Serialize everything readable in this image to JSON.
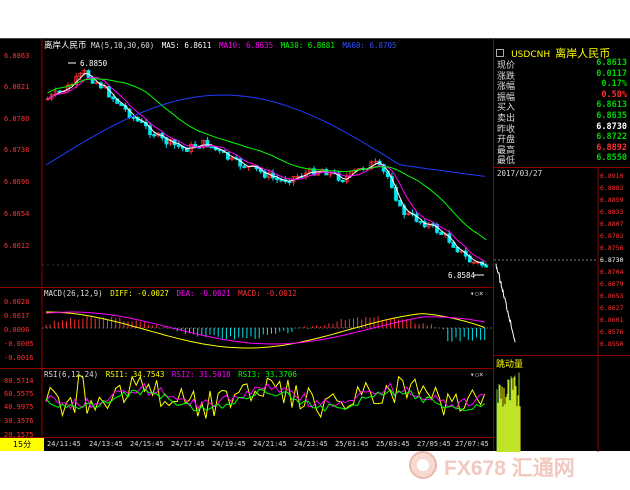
{
  "main": {
    "symbol": "离岸人民币",
    "ma_label": "MA(5,10,30,60)",
    "ma5": "MA5: 6.8611",
    "ma10": "MA10: 6.8635",
    "ma30": "MA30: 6.8681",
    "ma60": "MA60: 6.8705",
    "y_ticks": [
      "6.8863",
      "6.8821",
      "6.8780",
      "6.8738",
      "6.8696",
      "6.8654",
      "6.8612"
    ],
    "hi_label": "6.8850",
    "lo_label": "6.8584"
  },
  "macd": {
    "title": "MACD(26,12,9)",
    "diff": "DIFF: -0.0027",
    "dea": "DEA: -0.0021",
    "macd": "MACD: -0.0012",
    "y_ticks": [
      "0.0028",
      "0.0017",
      "0.0006",
      "-0.0005",
      "-0.0016"
    ]
  },
  "rsi": {
    "title": "RSI(6,12,24)",
    "rsi1": "RSI1: 34.7543",
    "rsi2": "RSI2: 31.5018",
    "rsi3": "RSI3: 33.3706",
    "y_ticks": [
      "80.5714",
      "60.5575",
      "40.9975",
      "30.3576",
      "20.1575"
    ]
  },
  "period_button": "15分",
  "x_ticks": [
    "24/11:45",
    "24/13:45",
    "24/15:45",
    "24/17:45",
    "24/19:45",
    "24/21:45",
    "24/23:45",
    "25/01:45",
    "25/03:45",
    "27/05:45",
    "27/07:45"
  ],
  "quote": {
    "code": "USDCNH",
    "name": "离岸人民币",
    "rows": [
      {
        "label": "现价",
        "value": "6.8613",
        "color": "#00d400"
      },
      {
        "label": "涨跌",
        "value": "0.0117",
        "color": "#00d400"
      },
      {
        "label": "涨幅",
        "value": "0.17%",
        "color": "#00d400"
      },
      {
        "label": "振幅",
        "value": "0.50%",
        "color": "#ff3030"
      },
      {
        "label": "买入",
        "value": "6.8613",
        "color": "#00d400"
      },
      {
        "label": "卖出",
        "value": "6.8635",
        "color": "#00d400"
      },
      {
        "label": "昨收",
        "value": "6.8730",
        "color": "#ffffff"
      },
      {
        "label": "开盘",
        "value": "6.8722",
        "color": "#00d400"
      },
      {
        "label": "最高",
        "value": "6.8892",
        "color": "#ff3030"
      },
      {
        "label": "最低",
        "value": "6.8550",
        "color": "#00d400"
      }
    ]
  },
  "intraday": {
    "date": "2017/03/27",
    "y_ticks": [
      "6.8910",
      "6.8882",
      "6.8859",
      "6.8833",
      "6.8807",
      "6.8782",
      "6.8756",
      "6.8730",
      "6.8704",
      "6.8679",
      "6.8653",
      "6.8627",
      "6.8601",
      "6.8576",
      "6.8550"
    ]
  },
  "volume_title": "跳动量",
  "watermark": "FX678 汇通网",
  "colors": {
    "up": "#ff3030",
    "down": "#00e5ee",
    "ma5": "#ffffff",
    "ma10": "#ff00ff",
    "ma30": "#00ff00",
    "ma60": "#1e3cff",
    "axis": "#8b0000",
    "yellow": "#ffff00"
  }
}
